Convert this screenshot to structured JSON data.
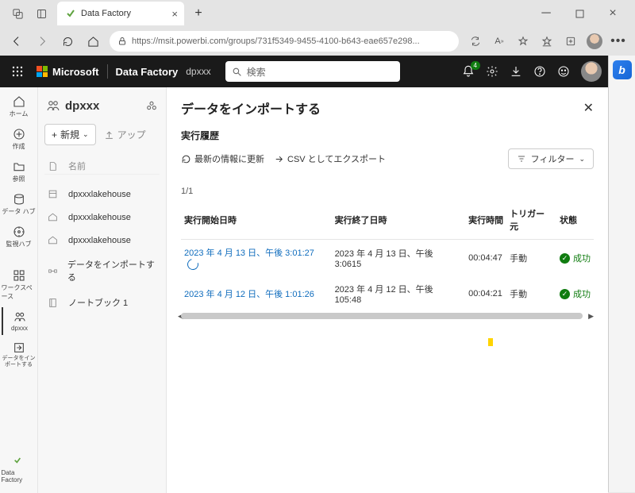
{
  "browser": {
    "tab_title": "Data Factory",
    "url": "https://msit.powerbi.com/groups/731f5349-9455-4100-b643-eae657e298..."
  },
  "topbar": {
    "brand": "Microsoft",
    "product": "Data Factory",
    "workspace": "dpxxx",
    "search_placeholder": "検索",
    "notif_count": "4"
  },
  "rail": {
    "home": "ホーム",
    "create": "作成",
    "browse": "参照",
    "datahub": "データ ハブ",
    "monitor": "監視ハブ",
    "workspaces": "ワークスペース",
    "dpxxx": "dpxxx",
    "import": "データをインポートする",
    "bottom": "Data Factory"
  },
  "ws": {
    "name": "dpxxx",
    "new_btn": "新規",
    "upload": "アップ",
    "col_name": "名前",
    "items": [
      "dpxxxlakehouse",
      "dpxxxlakehouse",
      "dpxxxlakehouse",
      "データをインポートする",
      "ノートブック 1"
    ]
  },
  "main": {
    "title": "データをインポートする",
    "section": "実行履歴",
    "refresh": "最新の情報に更新",
    "export_csv": "CSV としてエクスポート",
    "filter": "フィルター",
    "pager": "1/1",
    "cols": {
      "start": "実行開始日時",
      "end": "実行終了日時",
      "duration": "実行時間",
      "trigger": "トリガー元",
      "status": "状態"
    },
    "rows": [
      {
        "start": "2023 年 4 月 13 日、午後 3:01:27",
        "end": "2023 年 4 月 13 日、午後 3:0615",
        "duration": "00:04:47",
        "trigger": "手動",
        "status": "成功",
        "running": true
      },
      {
        "start": "2023 年 4 月 12 日、午後 1:01:26",
        "end": "2023 年 4 月 12 日、午後 105:48",
        "duration": "00:04:21",
        "trigger": "手動",
        "status": "成功",
        "running": false
      }
    ]
  }
}
